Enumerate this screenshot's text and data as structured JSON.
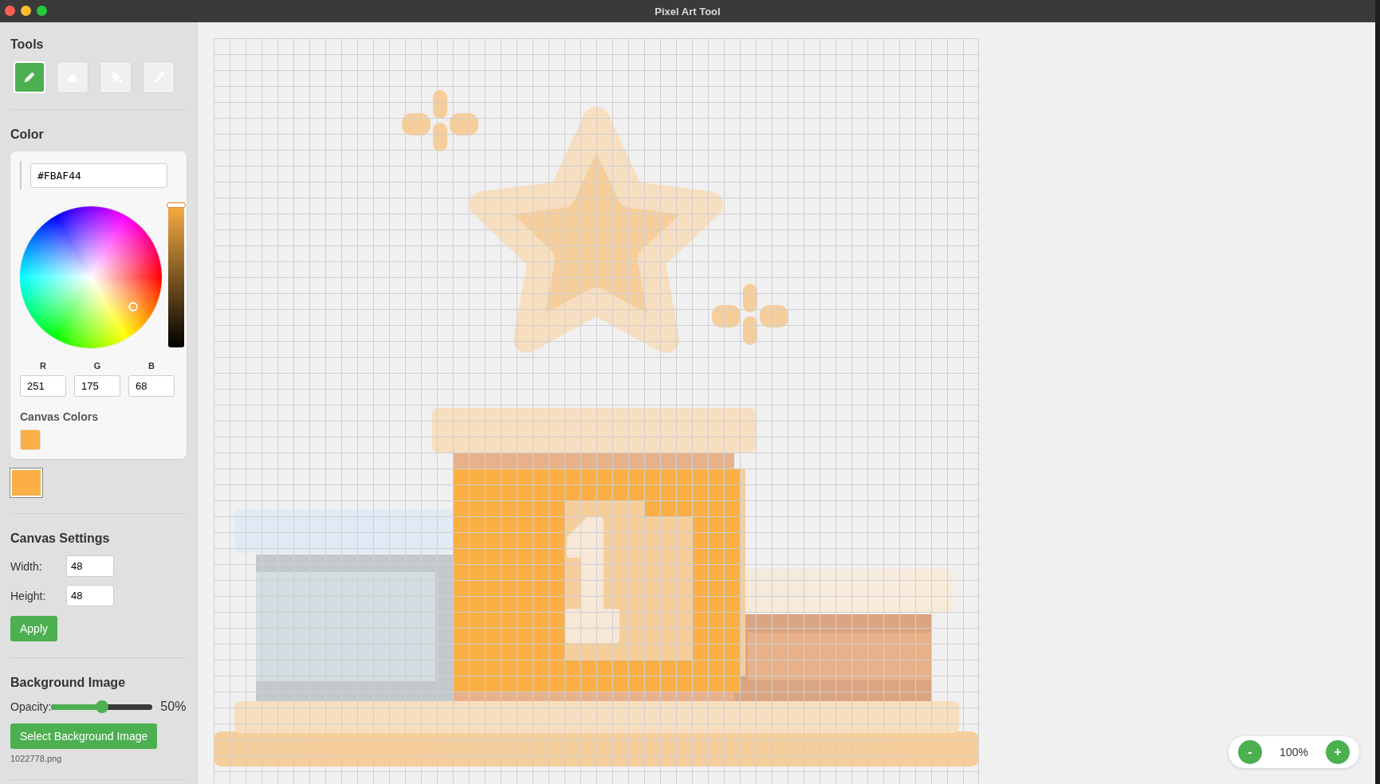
{
  "window": {
    "title": "Pixel Art Tool"
  },
  "sidebar": {
    "tools": {
      "heading": "Tools",
      "items": [
        {
          "kind": "pencil",
          "selected": true
        },
        {
          "kind": "eraser",
          "selected": false
        },
        {
          "kind": "fill",
          "selected": false
        },
        {
          "kind": "eyedropper",
          "selected": false
        }
      ]
    },
    "color": {
      "heading": "Color",
      "hex": "#FBAF44",
      "brightness": {
        "level": 1
      },
      "rgb": [
        {
          "label": "R",
          "value": "251"
        },
        {
          "label": "G",
          "value": "175"
        },
        {
          "label": "B",
          "value": "68"
        }
      ],
      "canvas_colors": {
        "heading": "Canvas Colors",
        "swatches": [
          {
            "color": "#fbaf44"
          }
        ]
      },
      "current": {
        "color": "#fbaf44"
      }
    },
    "canvas_settings": {
      "heading": "Canvas Settings",
      "fields": [
        {
          "label": "Width:",
          "value": "48"
        },
        {
          "label": "Height:",
          "value": "48"
        }
      ],
      "apply": "Apply"
    },
    "background_image": {
      "heading": "Background Image",
      "opacity_label": "Opacity:",
      "opacity": {
        "level": 0.5
      },
      "reading": "50%",
      "button": "Select Background Image",
      "filename": "1022778.png"
    }
  },
  "zoom": {
    "minus": "-",
    "reading": "100%",
    "plus": "+"
  }
}
